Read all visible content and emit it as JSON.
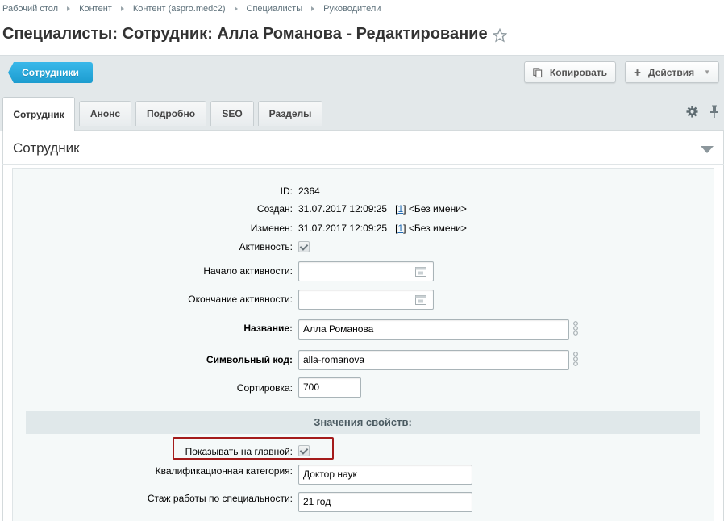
{
  "breadcrumb": [
    "Рабочий стол",
    "Контент",
    "Контент (aspro.medc2)",
    "Специалисты",
    "Руководители"
  ],
  "page_title": "Специалисты: Сотрудник: Алла Романова - Редактирование",
  "toolbar": {
    "back_label": "Сотрудники",
    "copy_label": "Копировать",
    "actions_label": "Действия"
  },
  "tabs": [
    "Сотрудник",
    "Анонс",
    "Подробно",
    "SEO",
    "Разделы"
  ],
  "section_title": "Сотрудник",
  "fields": {
    "id_label": "ID:",
    "id_value": "2364",
    "created_label": "Создан:",
    "created_date": "31.07.2017 12:09:25",
    "created_user_link": "1",
    "created_user_name": "<Без имени>",
    "modified_label": "Изменен:",
    "modified_date": "31.07.2017 12:09:25",
    "modified_user_link": "1",
    "modified_user_name": "<Без имени>",
    "active_label": "Активность:",
    "active_checked": true,
    "active_from_label": "Начало активности:",
    "active_from_value": "",
    "active_to_label": "Окончание активности:",
    "active_to_value": "",
    "name_label": "Название:",
    "name_value": "Алла Романова",
    "code_label": "Символьный код:",
    "code_value": "alla-romanova",
    "sort_label": "Сортировка:",
    "sort_value": "700"
  },
  "properties": {
    "header": "Значения свойств:",
    "show_main_label": "Показывать на главной:",
    "show_main_checked": true,
    "category_label": "Квалификационная категория:",
    "category_value": "Доктор наук",
    "experience_label": "Стаж работы по специальности:",
    "experience_value": "21 год"
  },
  "colors": {
    "accent": "#1c9ccf",
    "link": "#2067b0",
    "highlight_border": "#a41b1b"
  }
}
